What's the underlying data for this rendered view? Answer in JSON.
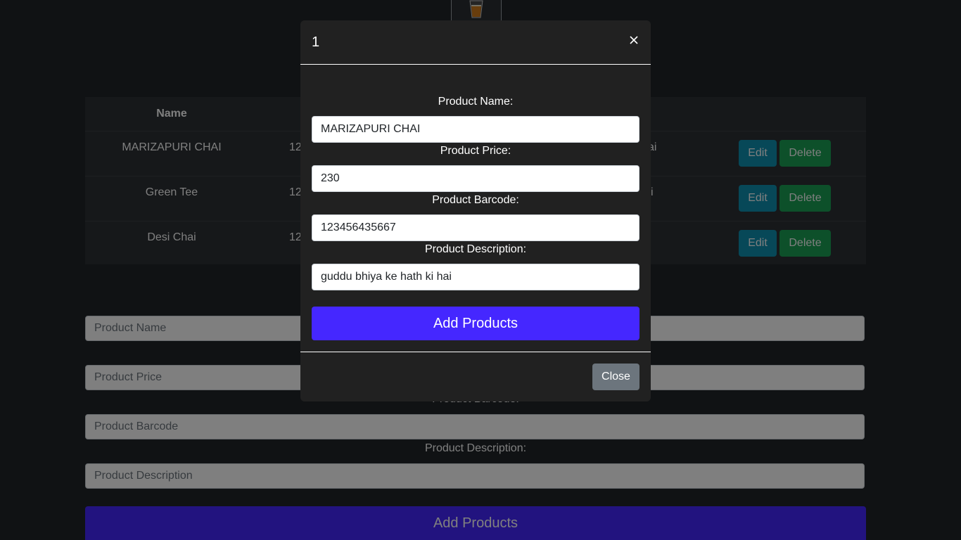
{
  "logo": {
    "icon": "tea-cup-icon"
  },
  "table": {
    "header": {
      "name": "Name"
    },
    "rows": [
      {
        "name": "MARIZAPURI CHAI",
        "barcode_fragment": "12",
        "desc_fragment": "ai",
        "edit": "Edit",
        "delete": "Delete"
      },
      {
        "name": "Green Tee",
        "barcode_fragment": "12",
        "desc_fragment": "i",
        "edit": "Edit",
        "delete": "Delete"
      },
      {
        "name": "Desi Chai",
        "barcode_fragment": "12",
        "desc_fragment": "",
        "edit": "Edit",
        "delete": "Delete"
      }
    ]
  },
  "form": {
    "name_placeholder": "Product Name",
    "price_placeholder": "Product Price",
    "barcode_label": "Product Barcode:",
    "barcode_placeholder": "Product Barcode",
    "description_label": "Product Description:",
    "description_placeholder": "Product Description",
    "add_button": "Add Products"
  },
  "modal": {
    "title": "1",
    "close_icon": "×",
    "name_label": "Product Name:",
    "name_value": "MARIZAPURI CHAI",
    "price_label": "Product Price:",
    "price_value": "230",
    "barcode_label": "Product Barcode:",
    "barcode_value": "123456435667",
    "description_label": "Product Description:",
    "description_value": "guddu bhiya ke hath ki hai",
    "add_button": "Add Products",
    "close_button": "Close"
  },
  "colors": {
    "accent": "#4527ff",
    "edit": "#0f90b0",
    "delete": "#1aa055",
    "secondary": "#6c757d"
  }
}
